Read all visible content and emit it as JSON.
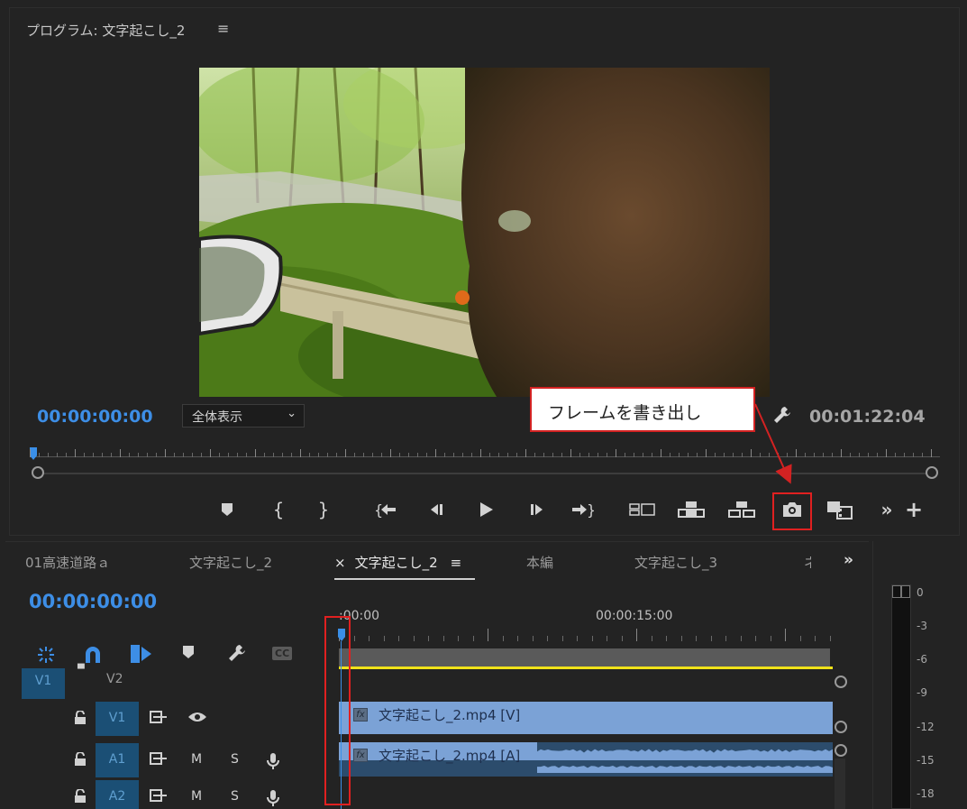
{
  "program_monitor": {
    "title": "プログラム: 文字起こし_2",
    "menu_icon": "hamburger-icon",
    "timecode_current": "00:00:00:00",
    "zoom_select": "全体表示",
    "timecode_duration": "00:01:22:04"
  },
  "callout": {
    "text": "フレームを書き出し"
  },
  "timeline": {
    "tabs": [
      {
        "label": "01高速道路ａ"
      },
      {
        "label": "文字起こし_2"
      },
      {
        "label": "文字起こし_2",
        "close": "×",
        "menu": "≡",
        "active": true
      },
      {
        "label": "本編"
      },
      {
        "label": "文字起こし_3"
      },
      {
        "label": "ネ"
      }
    ],
    "more": "»",
    "timecode": "00:00:00:00",
    "ruler_times": [
      ":00:00",
      "00:00:15:00"
    ],
    "tracks": {
      "v2": {
        "target": "V1",
        "label": "V2"
      },
      "v1": {
        "label": "V1"
      },
      "a1": {
        "label": "A1",
        "m": "M",
        "s": "S"
      },
      "a2": {
        "label": "A2",
        "m": "M",
        "s": "S"
      }
    },
    "clips": {
      "video": "文字起こし_2.mp4 [V]",
      "audio": "文字起こし_2.mp4 [A]",
      "fx": "fx"
    },
    "tool_cc": "CC"
  },
  "meters": {
    "ticks": [
      "0",
      "-3",
      "-6",
      "-9",
      "-12",
      "-15",
      "-18"
    ]
  },
  "colors": {
    "accent_blue": "#3d8ee6",
    "highlight_red": "#e02020",
    "clip_video": "#7ba2d6",
    "work_area_yellow": "#f1e21a"
  }
}
